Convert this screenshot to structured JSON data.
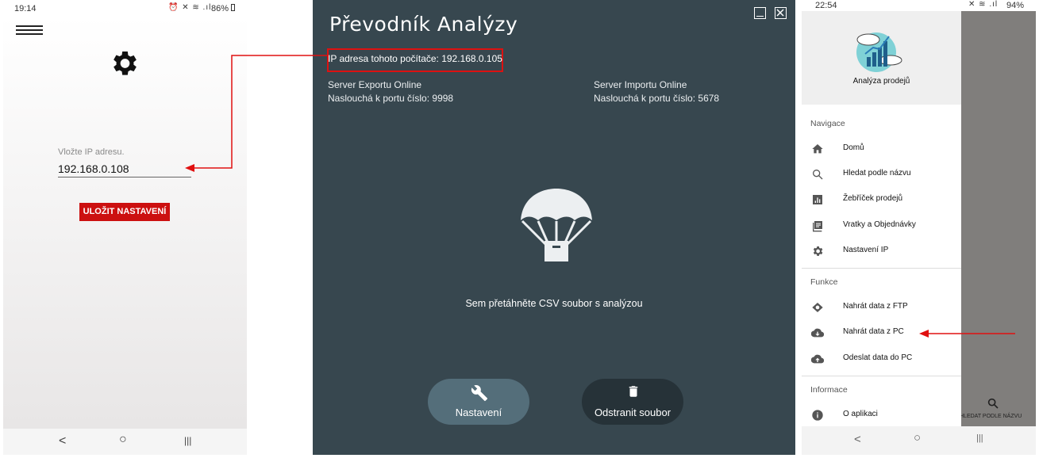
{
  "phone_left": {
    "status": {
      "time": "19:14",
      "battery": "86%"
    },
    "ip_label": "Vložte IP adresu.",
    "ip_value": "192.168.0.108",
    "save_button": "ULOŽIT NASTAVENÍ",
    "nav": {
      "back": "<",
      "home": "○",
      "recents": "|||"
    }
  },
  "desktop": {
    "title": "Převodník  Analýzy",
    "ip_text": "IP adresa tohoto počítače: 192.168.0.105",
    "export": {
      "title": "Server Exportu Online",
      "port": "Naslouchá k portu číslo: 9998"
    },
    "import": {
      "title": "Server Importu  Online",
      "port": "Naslouchá k portu číslo: 5678"
    },
    "drop_text": "Sem přetáhněte CSV soubor s analýzou",
    "settings_button": "Nastavení",
    "remove_button": "Odstranit soubor"
  },
  "phone_right": {
    "status": {
      "time": "22:54",
      "battery": "94%"
    },
    "app_name": "Analýza prodejů",
    "sections": {
      "navigation": "Navigace",
      "functions": "Funkce",
      "info": "Informace"
    },
    "nav_items": [
      "Domů",
      "Hledat podle názvu",
      "Žebříček prodejů",
      "Vratky a Objednávky",
      "Nastavení IP"
    ],
    "func_items": [
      "Nahrát data z FTP",
      "Nahrát data z PC",
      "Odeslat data do PC"
    ],
    "info_items": [
      "O aplikaci"
    ],
    "bg_label": "HLEDAT PODLE NÁZVU",
    "nav": {
      "back": "<",
      "home": "○",
      "recents": "|||"
    }
  },
  "colors": {
    "accent_red": "#cc1010",
    "window_bg": "#37474f",
    "arrow": "#e01010"
  }
}
